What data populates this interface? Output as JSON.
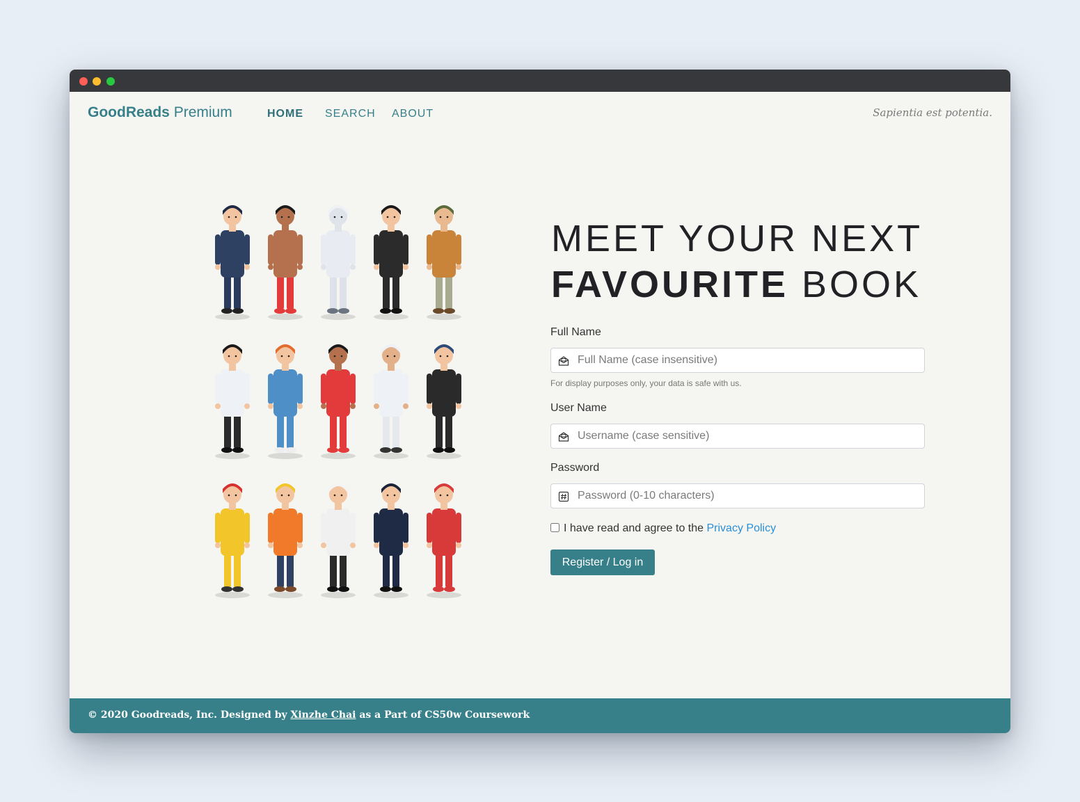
{
  "brand": {
    "bold": "GoodReads",
    "light": "Premium"
  },
  "nav": [
    "HOME",
    "SEARCH",
    "ABOUT"
  ],
  "motto": "Sapientia est potentia.",
  "heading": {
    "line1": "MEET YOUR NEXT",
    "bold": "FAVOURITE",
    "rest": "BOOK"
  },
  "form": {
    "fullname_label": "Full Name",
    "fullname_placeholder": "Full Name (case insensitive)",
    "fullname_hint": "For display purposes only, your data is safe with us.",
    "username_label": "User Name",
    "username_placeholder": "Username (case sensitive)",
    "password_label": "Password",
    "password_placeholder": "Password (0-10 characters)",
    "agree_text": "I have read and agree to the",
    "agree_link": "Privacy Policy",
    "submit": "Register / Log in"
  },
  "footer": {
    "prefix": "© 2020 Goodreads, Inc. Designed by",
    "author": "Xinzhe Chai",
    "suffix": "as a Part of CS50w Coursework"
  },
  "people": [
    {
      "name": "police-officer",
      "skin": "#f2c4a0",
      "hair": "#1f2a44",
      "top": "#2f4163",
      "bottom": "#2a3a5c",
      "shoes": "#222"
    },
    {
      "name": "boxer",
      "skin": "#b5714e",
      "hair": "#1a1a1a",
      "top": "#b5714e",
      "bottom": "#e33b3b",
      "shoes": "#e33b3b"
    },
    {
      "name": "astronaut",
      "skin": "#dfe3ea",
      "hair": "#eef1f5",
      "top": "#e8ecf2",
      "bottom": "#dde2ea",
      "shoes": "#6b7380"
    },
    {
      "name": "businessman",
      "skin": "#f2c4a0",
      "hair": "#1a1a1a",
      "top": "#2b2b2b",
      "bottom": "#2b2b2b",
      "shoes": "#111"
    },
    {
      "name": "soldier",
      "skin": "#e9b98f",
      "hair": "#5b6b3b",
      "top": "#c9843a",
      "bottom": "#a9ab91",
      "shoes": "#6b4a2a"
    },
    {
      "name": "doctor",
      "skin": "#f2c4a0",
      "hair": "#1a1a1a",
      "top": "#eef1f5",
      "bottom": "#2b2b2b",
      "shoes": "#111"
    },
    {
      "name": "nurse",
      "skin": "#f2c4a0",
      "hair": "#e36b2c",
      "top": "#4e8fc7",
      "bottom": "#4e8fc7",
      "shoes": "#eee"
    },
    {
      "name": "basketball-player",
      "skin": "#b5714e",
      "hair": "#1a1a1a",
      "top": "#e33b3b",
      "bottom": "#e33b3b",
      "shoes": "#e33b3b"
    },
    {
      "name": "arab-man",
      "skin": "#e3b08a",
      "hair": "#eef1f5",
      "top": "#eef1f5",
      "bottom": "#e5e8ec",
      "shoes": "#333"
    },
    {
      "name": "woman-hijab",
      "skin": "#f2c4a0",
      "hair": "#2c4a7a",
      "top": "#2a2a2a",
      "bottom": "#2a2a2a",
      "shoes": "#111"
    },
    {
      "name": "firefighter",
      "skin": "#f2c4a0",
      "hair": "#d8302f",
      "top": "#f2c52a",
      "bottom": "#f2c52a",
      "shoes": "#333"
    },
    {
      "name": "construction-worker",
      "skin": "#f2c4a0",
      "hair": "#f2c52a",
      "top": "#f07a2a",
      "bottom": "#2f4163",
      "shoes": "#7a4a2a"
    },
    {
      "name": "chef",
      "skin": "#f2c4a0",
      "hair": "#f4f4f4",
      "top": "#f0f0f0",
      "bottom": "#2b2b2b",
      "shoes": "#111"
    },
    {
      "name": "pilot",
      "skin": "#f2c4a0",
      "hair": "#1a2438",
      "top": "#1f2a44",
      "bottom": "#1f2a44",
      "shoes": "#111"
    },
    {
      "name": "flight-attendant",
      "skin": "#f2c4a0",
      "hair": "#d83a3a",
      "top": "#d83a3a",
      "bottom": "#d83a3a",
      "shoes": "#d83a3a"
    }
  ]
}
